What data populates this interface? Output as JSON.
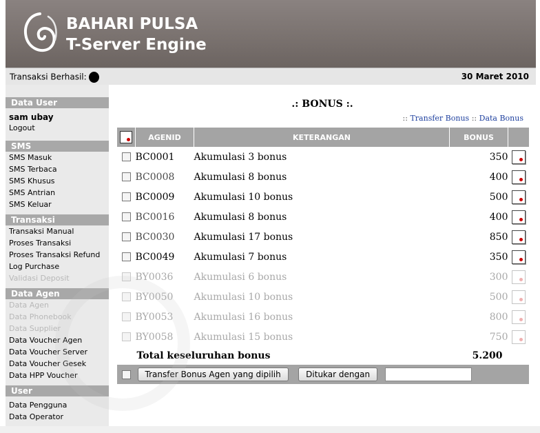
{
  "header": {
    "logo_icon": "swirl-logo-icon",
    "brand_line1": "BAHARI PULSA",
    "brand_line2": "T-Server Engine"
  },
  "infobar": {
    "status_label": "Transaksi Berhasil:",
    "date": "30 Maret 2010"
  },
  "sidebar": {
    "data_user": {
      "title": "Data User",
      "username": "sam ubay",
      "logout": "Logout"
    },
    "sms": {
      "title": "SMS",
      "items": [
        "SMS Masuk",
        "SMS Terbaca",
        "SMS Khusus",
        "SMS Antrian",
        "SMS Keluar"
      ]
    },
    "transaksi": {
      "title": "Transaksi",
      "items": [
        "Transaksi Manual",
        "Proses Transaksi",
        "Proses Transaksi Refund",
        "Log Purchase",
        "Validasi Deposit"
      ]
    },
    "data_agen": {
      "title": "Data Agen",
      "items": [
        "Data Agen",
        "Data Phonebook",
        "Data Supplier",
        "Data Voucher Agen",
        "Data Voucher Server",
        "Data Voucher Gesek",
        "Data HPP Voucher"
      ]
    },
    "user": {
      "title": "User",
      "items": [
        "Data Pengguna",
        "Data Operator"
      ]
    }
  },
  "main": {
    "title": ".: BONUS :.",
    "links": {
      "prefix": "::",
      "transfer": "Transfer Bonus",
      "sep": "::",
      "data": "Data Bonus"
    },
    "table": {
      "headers": {
        "agenid": "AGENID",
        "keterangan": "KETERANGAN",
        "bonus": "BONUS"
      },
      "rows": [
        {
          "agenid": "BC0001",
          "keterangan": "Akumulasi 3 bonus",
          "bonus": "350"
        },
        {
          "agenid": "BC0008",
          "keterangan": "Akumulasi 8 bonus",
          "bonus": "400"
        },
        {
          "agenid": "BC0009",
          "keterangan": "Akumulasi 10 bonus",
          "bonus": "500"
        },
        {
          "agenid": "BC0016",
          "keterangan": "Akumulasi 8 bonus",
          "bonus": "400"
        },
        {
          "agenid": "BC0030",
          "keterangan": "Akumulasi 17 bonus",
          "bonus": "850"
        },
        {
          "agenid": "BC0049",
          "keterangan": "Akumulasi 7 bonus",
          "bonus": "350"
        },
        {
          "agenid": "BY0036",
          "keterangan": "Akumulasi 6 bonus",
          "bonus": "300"
        },
        {
          "agenid": "BY0050",
          "keterangan": "Akumulasi 10 bonus",
          "bonus": "500"
        },
        {
          "agenid": "BY0053",
          "keterangan": "Akumulasi 16 bonus",
          "bonus": "800"
        },
        {
          "agenid": "BY0058",
          "keterangan": "Akumulasi 15 bonus",
          "bonus": "750"
        }
      ],
      "total_label": "Total keseluruhan bonus",
      "total_value": "5.200"
    },
    "buttons": {
      "transfer": "Transfer Bonus Agen yang dipilih",
      "tukar": "Ditukar dengan"
    },
    "tukar_input_value": ""
  },
  "colors": {
    "header_bg": "#7a726f",
    "section_bg": "#a8a8a8",
    "table_header_bg": "#a4a4a4",
    "link": "#1d3f9e",
    "icon_dot": "#cc0000"
  }
}
